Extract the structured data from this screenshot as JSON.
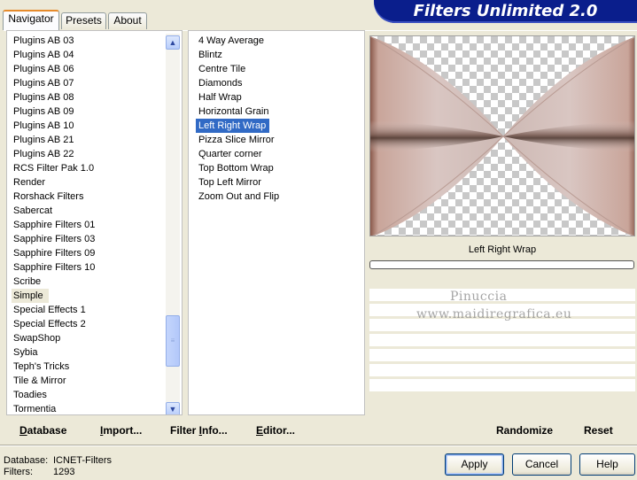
{
  "tabs": [
    {
      "label": "Navigator",
      "active": true
    },
    {
      "label": "Presets",
      "active": false
    },
    {
      "label": "About",
      "active": false
    }
  ],
  "title": "Filters Unlimited 2.0",
  "categories": [
    "Plugins AB 03",
    "Plugins AB 04",
    "Plugins AB 06",
    "Plugins AB 07",
    "Plugins AB 08",
    "Plugins AB 09",
    "Plugins AB 10",
    "Plugins AB 21",
    "Plugins AB 22",
    "RCS Filter Pak 1.0",
    "Render",
    "Rorshack Filters",
    "Sabercat",
    "Sapphire Filters 01",
    "Sapphire Filters 03",
    "Sapphire Filters 09",
    "Sapphire Filters 10",
    "Scribe",
    "Simple",
    "Special Effects 1",
    "Special Effects 2",
    "SwapShop",
    "Sybia",
    "Teph's Tricks",
    "Tile & Mirror",
    "Toadies",
    "Tormentia"
  ],
  "selected_category": "Simple",
  "filters": [
    "4 Way Average",
    "Blintz",
    "Centre Tile",
    "Diamonds",
    "Half Wrap",
    "Horizontal Grain",
    "Left Right Wrap",
    "Pizza Slice Mirror",
    "Quarter corner",
    "Top Bottom Wrap",
    "Top Left Mirror",
    "Zoom Out and Flip"
  ],
  "selected_filter": "Left Right Wrap",
  "preview": {
    "filter_name": "Left Right Wrap"
  },
  "watermark": {
    "line1": "Pinuccia",
    "line2": "www.maidiregrafica.eu"
  },
  "bottom_left": {
    "database": "Database",
    "import": "Import...",
    "filter_info": "Filter Info...",
    "editor": "Editor..."
  },
  "bottom_right": {
    "randomize": "Randomize",
    "reset": "Reset"
  },
  "status": {
    "database_label": "Database:",
    "database_value": "ICNET-Filters",
    "filters_label": "Filters:",
    "filters_value": "1293"
  },
  "buttons": {
    "apply": "Apply",
    "cancel": "Cancel",
    "help": "Help"
  },
  "colors": {
    "title_bar": "#0a1e8c",
    "selection": "#316ac5",
    "face": "#ece9d8"
  },
  "icons": {
    "scroll_up": "chevron-up-icon",
    "scroll_down": "chevron-down-icon"
  }
}
